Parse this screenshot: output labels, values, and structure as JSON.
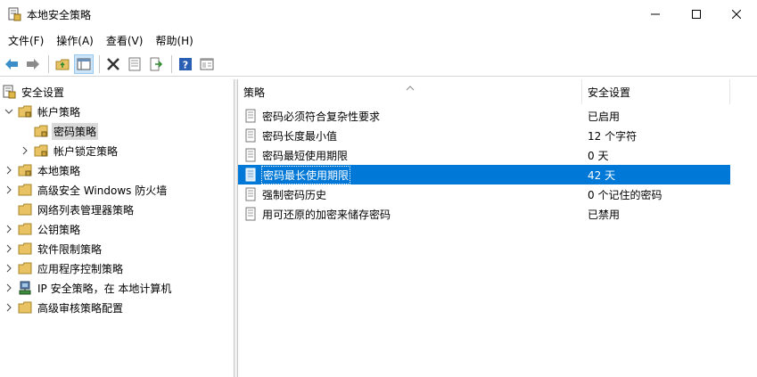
{
  "window": {
    "title": "本地安全策略"
  },
  "menu": [
    {
      "label": "文件(F)"
    },
    {
      "label": "操作(A)"
    },
    {
      "label": "查看(V)"
    },
    {
      "label": "帮助(H)"
    }
  ],
  "toolbar_icons": [
    "back-arrow-icon",
    "forward-arrow-icon",
    "up-folder-icon",
    "show-hide-tree-icon",
    "delete-icon",
    "properties-icon",
    "export-list-icon",
    "help-icon",
    "console-view-icon"
  ],
  "tree": {
    "root": "安全设置",
    "items": [
      {
        "label": "帐户策略",
        "expanded": true
      },
      {
        "label": "密码策略",
        "selected": true
      },
      {
        "label": "帐户锁定策略"
      },
      {
        "label": "本地策略"
      },
      {
        "label": "高级安全 Windows 防火墙"
      },
      {
        "label": "网络列表管理器策略"
      },
      {
        "label": "公钥策略"
      },
      {
        "label": "软件限制策略"
      },
      {
        "label": "应用程序控制策略"
      },
      {
        "label": "IP 安全策略，在 本地计算机"
      },
      {
        "label": "高级审核策略配置"
      }
    ]
  },
  "list": {
    "columns": {
      "policy": "策略",
      "setting": "安全设置"
    },
    "rows": [
      {
        "policy": "密码必须符合复杂性要求",
        "setting": "已启用"
      },
      {
        "policy": "密码长度最小值",
        "setting": "12 个字符"
      },
      {
        "policy": "密码最短使用期限",
        "setting": "0 天"
      },
      {
        "policy": "密码最长使用期限",
        "setting": "42 天",
        "selected": true
      },
      {
        "policy": "强制密码历史",
        "setting": "0 个记住的密码"
      },
      {
        "policy": "用可还原的加密来储存密码",
        "setting": "已禁用"
      }
    ]
  },
  "colors": {
    "selection": "#0078d7",
    "folder": "#e8c263"
  }
}
